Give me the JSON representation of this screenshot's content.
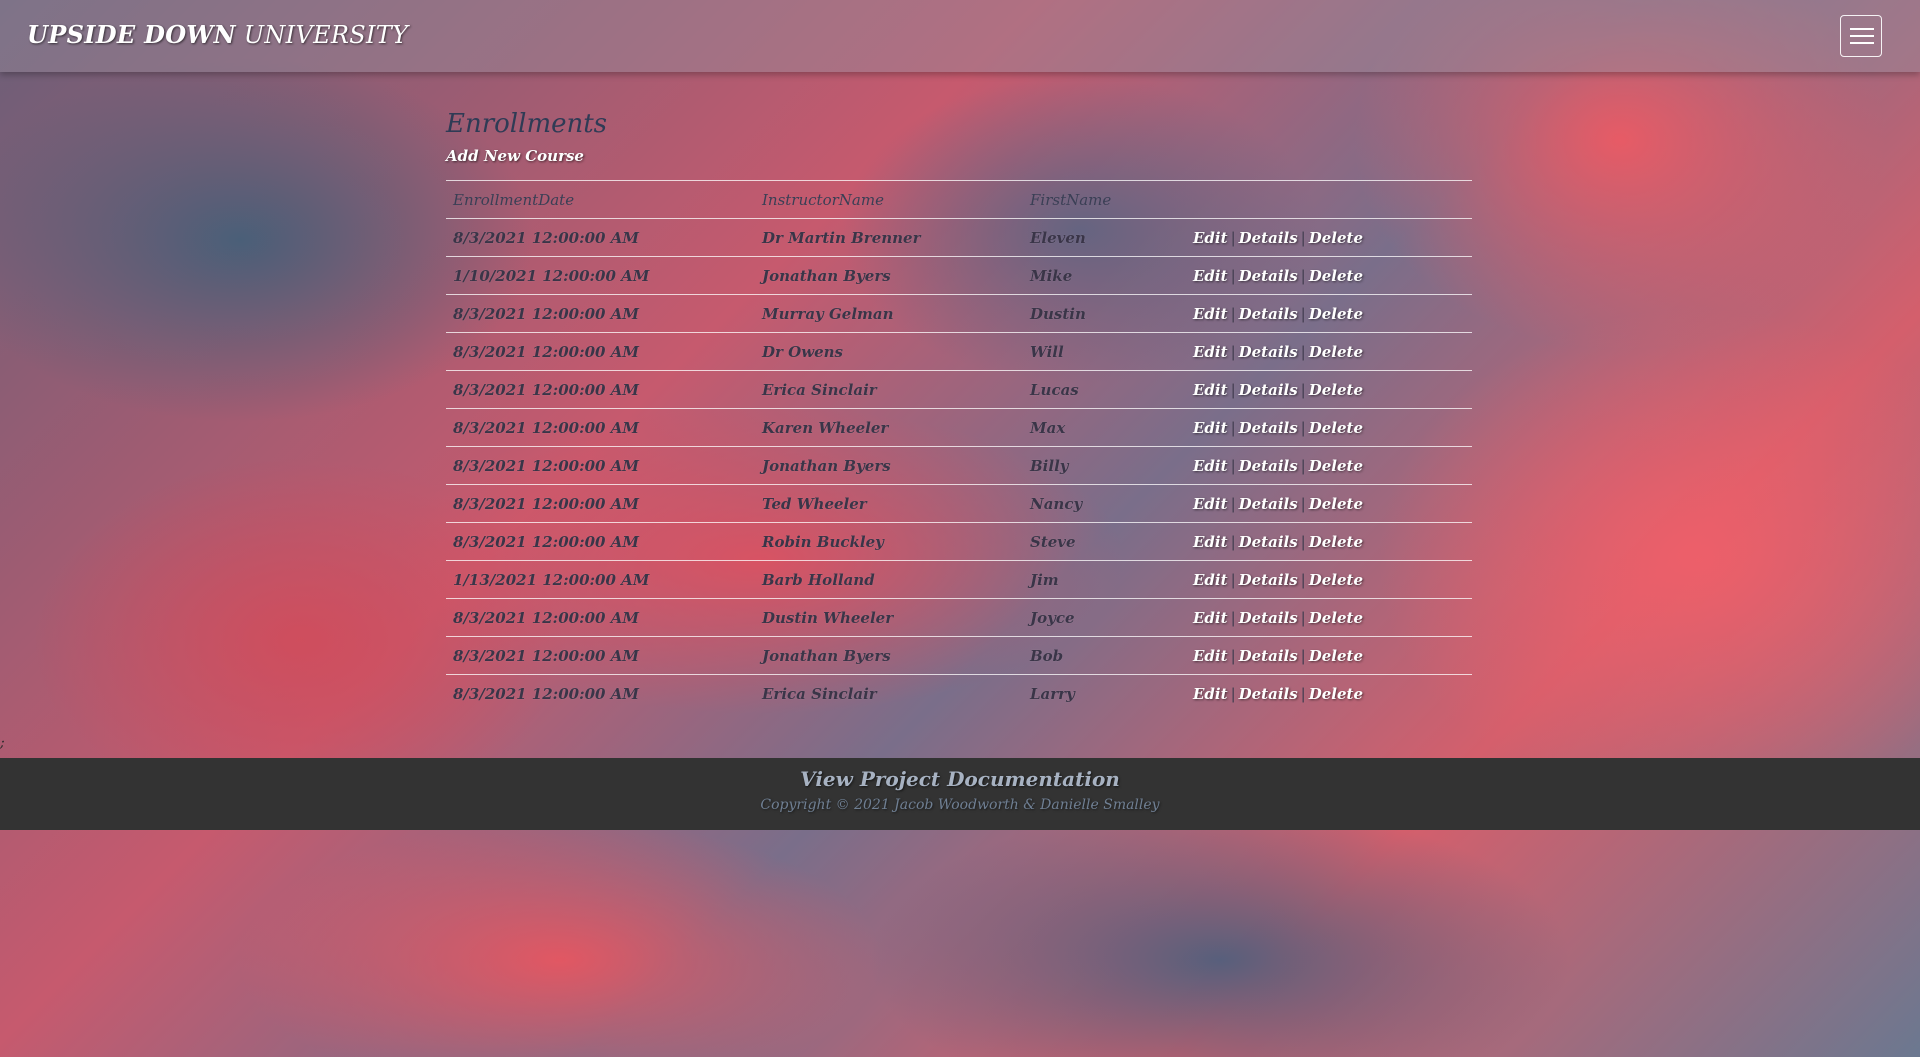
{
  "navbar": {
    "brand_bold": "UPSIDE DOWN",
    "brand_light": "UNIVERSITY",
    "menu_icon": "hamburger-menu-icon"
  },
  "page": {
    "title": "Enrollments",
    "add_link": "Add New Course"
  },
  "table": {
    "headers": [
      "EnrollmentDate",
      "InstructorName",
      "FirstName"
    ],
    "actions": {
      "edit": "Edit",
      "details": "Details",
      "delete": "Delete",
      "separator": "|"
    },
    "rows": [
      {
        "date": "8/3/2021 12:00:00 AM",
        "instructor": "Dr Martin Brenner",
        "first": "Eleven"
      },
      {
        "date": "1/10/2021 12:00:00 AM",
        "instructor": "Jonathan Byers",
        "first": "Mike"
      },
      {
        "date": "8/3/2021 12:00:00 AM",
        "instructor": "Murray Gelman",
        "first": "Dustin"
      },
      {
        "date": "8/3/2021 12:00:00 AM",
        "instructor": "Dr Owens",
        "first": "Will"
      },
      {
        "date": "8/3/2021 12:00:00 AM",
        "instructor": "Erica Sinclair",
        "first": "Lucas"
      },
      {
        "date": "8/3/2021 12:00:00 AM",
        "instructor": "Karen Wheeler",
        "first": "Max"
      },
      {
        "date": "8/3/2021 12:00:00 AM",
        "instructor": "Jonathan Byers",
        "first": "Billy"
      },
      {
        "date": "8/3/2021 12:00:00 AM",
        "instructor": "Ted Wheeler",
        "first": "Nancy"
      },
      {
        "date": "8/3/2021 12:00:00 AM",
        "instructor": "Robin Buckley",
        "first": "Steve"
      },
      {
        "date": "1/13/2021 12:00:00 AM",
        "instructor": "Barb Holland",
        "first": "Jim"
      },
      {
        "date": "8/3/2021 12:00:00 AM",
        "instructor": "Dustin Wheeler",
        "first": "Joyce"
      },
      {
        "date": "8/3/2021 12:00:00 AM",
        "instructor": "Jonathan Byers",
        "first": "Bob"
      },
      {
        "date": "8/3/2021 12:00:00 AM",
        "instructor": "Erica Sinclair",
        "first": "Larry"
      }
    ]
  },
  "stray_text": ";",
  "footer": {
    "doc_link": "View Project Documentation",
    "copyright": "Copyright © 2021 Jacob Woodworth & Danielle Smalley"
  },
  "colors": {
    "footer_bg": "#333333",
    "link": "#ffffff",
    "title": "#2f3b55"
  }
}
